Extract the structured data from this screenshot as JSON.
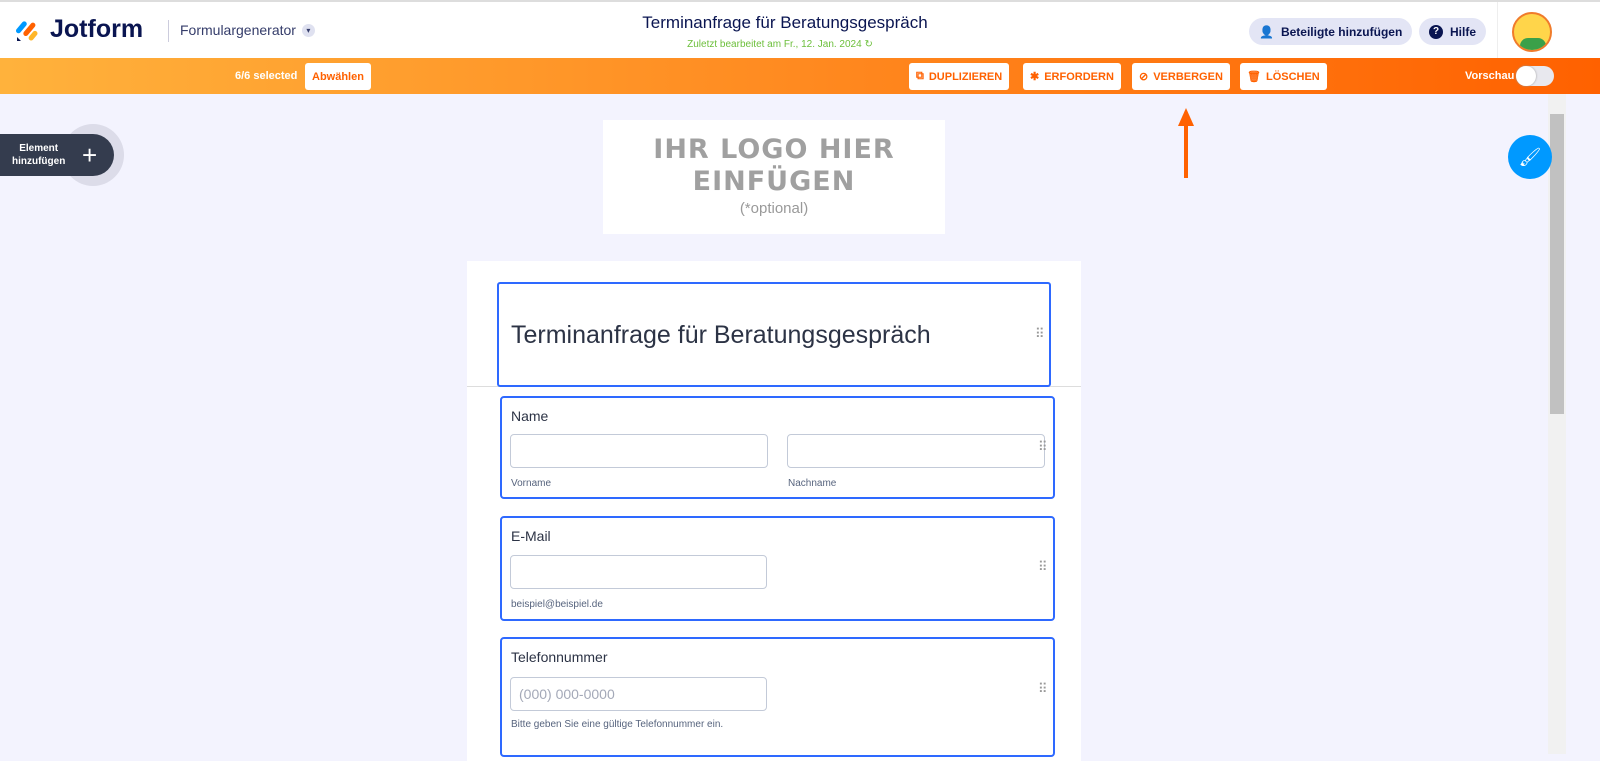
{
  "header": {
    "brand": "Jotform",
    "builder": "Formulargenerator",
    "title": "Terminanfrage für Beratungsgespräch",
    "subtitle": "Zuletzt bearbeitet am Fr., 12. Jan. 2024",
    "add_participants": "Beteiligte hinzufügen",
    "help": "Hilfe"
  },
  "toolbar": {
    "selected": "6/6 selected",
    "deselect": "Abwählen",
    "duplicate": "DUPLIZIEREN",
    "require": "ERFORDERN",
    "hide": "VERBERGEN",
    "delete": "LÖSCHEN",
    "preview": "Vorschau",
    "preview_on": false
  },
  "sidebar": {
    "add_element_line1": "Element",
    "add_element_line2": "hinzufügen"
  },
  "logo": {
    "line1": "IHR LOGO HIER",
    "line2": "EINFÜGEN",
    "optional": "(*optional)"
  },
  "form": {
    "heading": "Terminanfrage für Beratungsgespräch",
    "name": {
      "label": "Name",
      "first": "Vorname",
      "last": "Nachname"
    },
    "email": {
      "label": "E-Mail",
      "sublabel": "beispiel@beispiel.de"
    },
    "phone": {
      "label": "Telefonnummer",
      "placeholder": "(000) 000-0000",
      "sublabel": "Bitte geben Sie eine gültige Telefonnummer ein."
    }
  },
  "colors": {
    "accent": "#ff6100",
    "selection": "#2e69ff",
    "canvas": "#f3f3fe"
  }
}
